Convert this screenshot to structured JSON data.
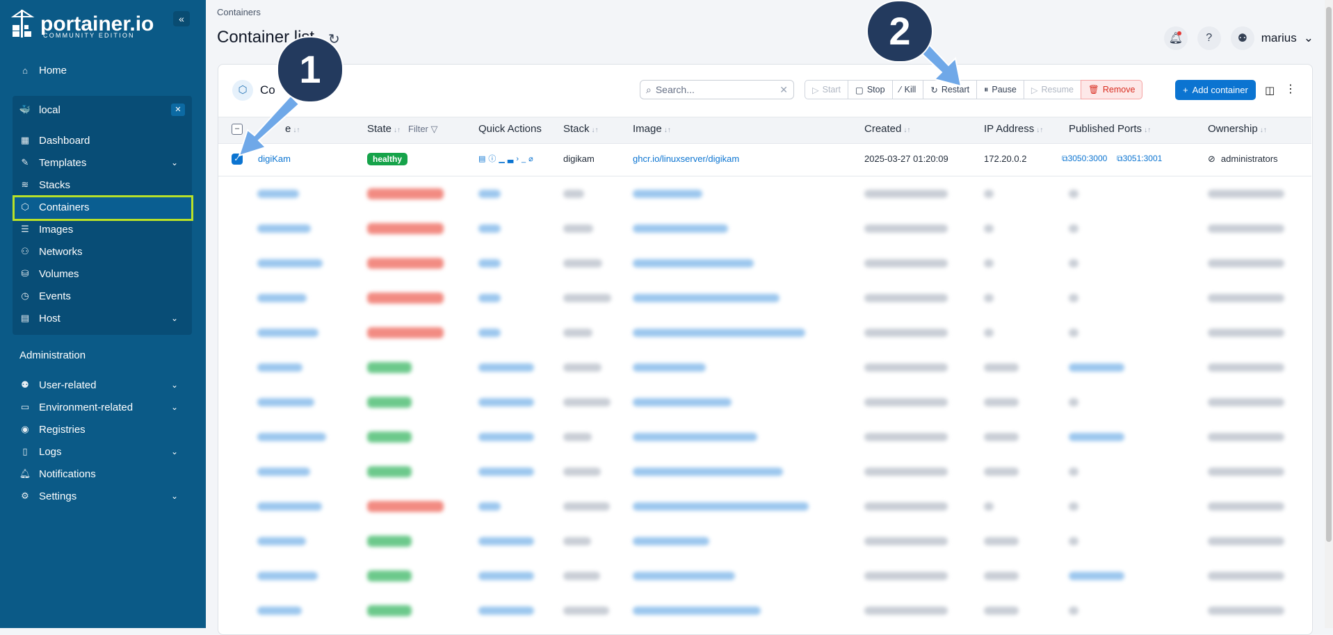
{
  "brand": {
    "name": "portainer.io",
    "edition": "COMMUNITY EDITION"
  },
  "sidebar": {
    "home": "Home",
    "environment": "local",
    "env_items": [
      {
        "label": "Dashboard",
        "icon": "dashboard-icon"
      },
      {
        "label": "Templates",
        "icon": "edit-icon",
        "expandable": true
      },
      {
        "label": "Stacks",
        "icon": "layers-icon"
      },
      {
        "label": "Containers",
        "icon": "cube-icon",
        "active": true
      },
      {
        "label": "Images",
        "icon": "list-icon"
      },
      {
        "label": "Networks",
        "icon": "network-icon"
      },
      {
        "label": "Volumes",
        "icon": "database-icon"
      },
      {
        "label": "Events",
        "icon": "clock-icon"
      },
      {
        "label": "Host",
        "icon": "server-icon",
        "expandable": true
      }
    ],
    "admin_header": "Administration",
    "admin_items": [
      {
        "label": "User-related",
        "icon": "user-icon",
        "expandable": true
      },
      {
        "label": "Environment-related",
        "icon": "hdd-icon",
        "expandable": true
      },
      {
        "label": "Registries",
        "icon": "radio-icon"
      },
      {
        "label": "Logs",
        "icon": "file-icon",
        "expandable": true
      },
      {
        "label": "Notifications",
        "icon": "bell-icon"
      },
      {
        "label": "Settings",
        "icon": "gear-icon",
        "expandable": true
      }
    ]
  },
  "header": {
    "breadcrumb": "Containers",
    "title": "Container list",
    "user": "marius"
  },
  "panel": {
    "title": "Co",
    "search_placeholder": "Search...",
    "actions": {
      "start": "Start",
      "stop": "Stop",
      "kill": "Kill",
      "restart": "Restart",
      "pause": "Pause",
      "resume": "Resume",
      "remove": "Remove"
    },
    "add_button": "Add container",
    "columns": {
      "name": "e",
      "state": "State",
      "filter": "Filter",
      "quick_actions": "Quick Actions",
      "stack": "Stack",
      "image": "Image",
      "created": "Created",
      "ip": "IP Address",
      "ports": "Published Ports",
      "ownership": "Ownership"
    },
    "row": {
      "name": "digiKam",
      "state": "healthy",
      "stack": "digikam",
      "image": "ghcr.io/linuxserver/digikam",
      "created": "2025-03-27 01:20:09",
      "ip": "172.20.0.2",
      "port1": "3050:3000",
      "port2": "3051:3001",
      "ownership": "administrators"
    }
  },
  "annotations": {
    "one": "1",
    "two": "2"
  },
  "colors": {
    "sidebar": "#0b5a87",
    "highlight": "#b9e128",
    "accent": "#0b74d1",
    "healthy": "#16a34a",
    "callout": "#233a5e",
    "arrow": "#6fa8e8"
  }
}
